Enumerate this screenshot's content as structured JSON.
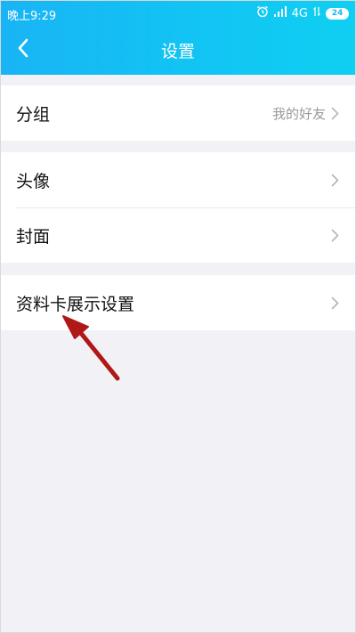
{
  "status_bar": {
    "time": "晚上9:29",
    "network": "4G",
    "battery": "24"
  },
  "header": {
    "title": "设置"
  },
  "groups": [
    {
      "items": [
        {
          "label": "分组",
          "value": "我的好友"
        }
      ]
    },
    {
      "items": [
        {
          "label": "头像"
        },
        {
          "label": "封面"
        }
      ]
    },
    {
      "items": [
        {
          "label": "资料卡展示设置"
        }
      ]
    }
  ],
  "colors": {
    "header_gradient_start": "#19b4f5",
    "header_gradient_end": "#0fcff2",
    "page_bg": "#f2f2f6",
    "annotation_arrow": "#b01818"
  }
}
